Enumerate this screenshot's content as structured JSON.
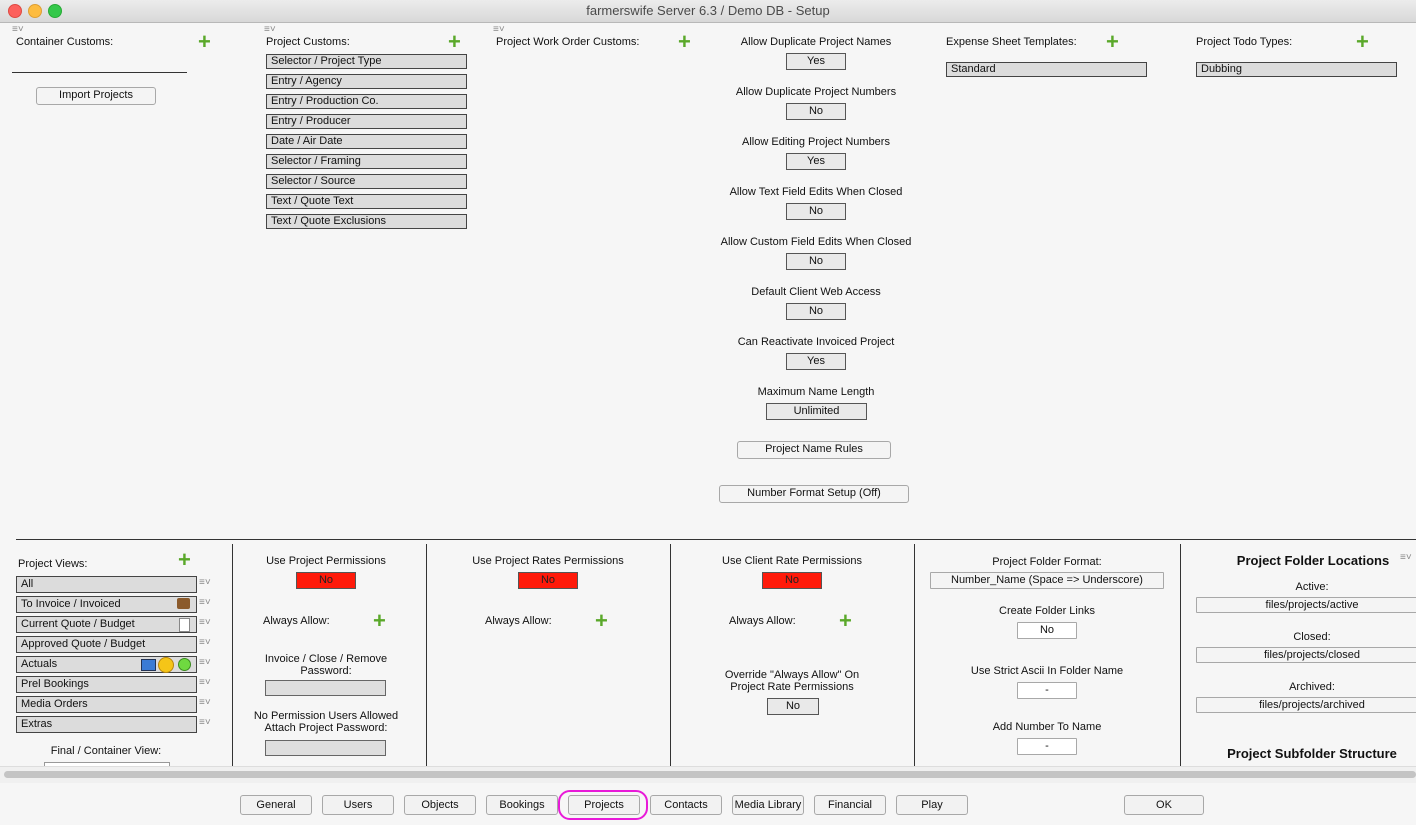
{
  "window": {
    "title": "farmerswife Server 6.3  / Demo DB - Setup"
  },
  "top": {
    "container_customs": {
      "label": "Container Customs:",
      "import_button": "Import Projects"
    },
    "project_customs": {
      "label": "Project Customs:",
      "items": [
        "Selector / Project Type",
        "Entry / Agency",
        "Entry / Production Co.",
        "Entry / Producer",
        "Date / Air Date",
        "Selector / Framing",
        "Selector / Source",
        "Text / Quote Text",
        "Text / Quote Exclusions"
      ]
    },
    "work_order_customs": {
      "label": "Project Work Order Customs:"
    },
    "settings": [
      {
        "label": "Allow Duplicate Project Names",
        "value": "Yes"
      },
      {
        "label": "Allow Duplicate Project Numbers",
        "value": "No"
      },
      {
        "label": "Allow Editing Project Numbers",
        "value": "Yes"
      },
      {
        "label": "Allow Text Field Edits When Closed",
        "value": "No"
      },
      {
        "label": "Allow Custom Field Edits When Closed",
        "value": "No"
      },
      {
        "label": "Default Client Web Access",
        "value": "No"
      },
      {
        "label": "Can Reactivate Invoiced Project",
        "value": "Yes"
      },
      {
        "label": "Maximum Name Length",
        "value": "Unlimited"
      }
    ],
    "name_rules_button": "Project Name Rules",
    "number_format_button": "Number Format Setup (Off)",
    "expense_templates": {
      "label": "Expense Sheet Templates:",
      "items": [
        "Standard"
      ]
    },
    "todo_types": {
      "label": "Project Todo Types:",
      "items": [
        "Dubbing"
      ]
    }
  },
  "bottom": {
    "project_views": {
      "label": "Project Views:",
      "items": [
        "All",
        "To Invoice / Invoiced",
        "Current Quote / Budget",
        "Approved Quote / Budget",
        "Actuals",
        "Prel Bookings",
        "Media Orders",
        "Extras"
      ],
      "final_label": "Final / Container View:"
    },
    "permissions": {
      "label": "Use Project Permissions",
      "value": "No",
      "always_allow": "Always Allow:",
      "pw1_label": "Invoice / Close / Remove Password:",
      "pw2_label": "No Permission Users Allowed Attach Project Password:"
    },
    "rates_permissions": {
      "label": "Use Project Rates Permissions",
      "value": "No",
      "always_allow": "Always Allow:"
    },
    "client_rate": {
      "label": "Use Client Rate Permissions",
      "value": "No",
      "always_allow": "Always Allow:",
      "override_label": "Override \"Always Allow\" On Project Rate Permissions",
      "override_value": "No"
    },
    "folder": {
      "format_label": "Project Folder Format:",
      "format_value": "Number_Name (Space => Underscore)",
      "links_label": "Create Folder Links",
      "links_value": "No",
      "ascii_label": "Use Strict Ascii In Folder Name",
      "ascii_value": "-",
      "addnum_label": "Add Number To Name",
      "addnum_value": "-"
    },
    "locations": {
      "title": "Project Folder Locations",
      "active_label": "Active:",
      "active_value": "files/projects/active",
      "closed_label": "Closed:",
      "closed_value": "files/projects/closed",
      "archived_label": "Archived:",
      "archived_value": "files/projects/archived",
      "subfolder_title": "Project Subfolder Structure"
    }
  },
  "tabs": [
    "General",
    "Users",
    "Objects",
    "Bookings",
    "Projects",
    "Contacts",
    "Media Library",
    "Financial",
    "Play"
  ],
  "ok_button": "OK",
  "colors": {
    "accent_plus": "#5aa82a",
    "red": "#ff1a0a",
    "highlight": "#e81ad8"
  }
}
